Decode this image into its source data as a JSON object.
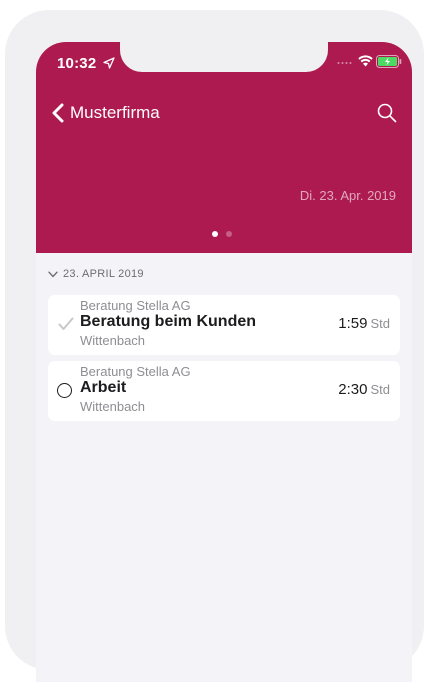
{
  "status_bar": {
    "time": "10:32"
  },
  "nav": {
    "back_label": "Musterfirma"
  },
  "header": {
    "date": "Di. 23. Apr. 2019",
    "page_count": 2,
    "active_page": 1,
    "color": "#ad1a4f"
  },
  "section": {
    "title": "23. APRIL 2019"
  },
  "entries": [
    {
      "client": "Beratung Stella AG",
      "task": "Beratung beim Kunden",
      "location": "Wittenbach",
      "duration": "1:59",
      "unit": "Std",
      "status": "check-icon"
    },
    {
      "client": "Beratung Stella AG",
      "task": "Arbeit",
      "location": "Wittenbach",
      "duration": "2:30",
      "unit": "Std",
      "status": "circle-icon"
    }
  ]
}
